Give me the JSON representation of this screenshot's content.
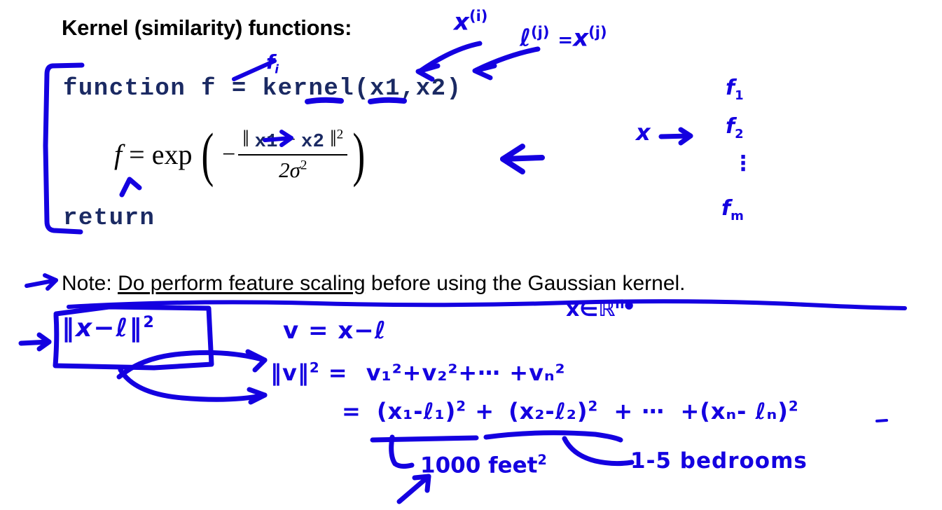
{
  "slide": {
    "title": "Kernel (similarity) functions:",
    "code": {
      "line1": "function f = kernel(x1,x2)",
      "line2": "return"
    },
    "equation": {
      "lhs": "f",
      "equals": "=",
      "exp": "exp",
      "open_paren": "(",
      "minus": "−",
      "numerator_open": "‖",
      "numerator_a": "x1",
      "numerator_minus": "−",
      "numerator_b": "x2",
      "numerator_close": "‖",
      "numerator_power": "2",
      "denominator": "2σ",
      "denominator_power": "2",
      "close_paren": ")"
    },
    "note": {
      "lead": "Note:",
      "underlined": "Do perform feature scaling",
      "tail": " before using the Gaussian kernel."
    }
  },
  "annotations": {
    "f_sub_i": "f",
    "f_sub_i_sub": "i",
    "x_superscript_i": "x",
    "x_superscript_i_sup": "(i)",
    "l_superscript_j": "ℓ",
    "l_superscript_j_sup": "(j)",
    "l_equals": "=",
    "x_superscript_j": "x",
    "x_superscript_j_sup": "(j)",
    "x_maps": "x",
    "feature_list": [
      "f",
      "f",
      "⋮",
      "f"
    ],
    "feature_subs": [
      "1",
      "2",
      "",
      "m"
    ],
    "boxed_norm_open": "‖",
    "boxed_norm_x": "x",
    "boxed_norm_minus": "−",
    "boxed_norm_l": "ℓ",
    "boxed_norm_close": "‖",
    "boxed_norm_power": "2",
    "v_def": "v = x−ℓ",
    "norm_v": "‖v‖",
    "norm_v_power": "2",
    "norm_v_equals": "=",
    "norm_v_expansion": "v₁²+v₂²+⋯ +vₙ²",
    "expansion_equals": "=",
    "expansion_term1": "(x₁-ℓ₁)",
    "expansion_term1_pow": "2",
    "expansion_plus1": "+",
    "expansion_term2": "(x₂-ℓ₂)",
    "expansion_term2_pow": "2",
    "expansion_plus2": "+ ⋯",
    "expansion_plus3": "+",
    "expansion_termn": "(xₙ- ℓₙ)",
    "expansion_termn_pow": "2",
    "x_in_rn": "x∈ℝ",
    "x_in_rn_sup": "n",
    "x_in_rn_scribble": "●",
    "units_feet": "1000 feet",
    "units_feet_sup": "2",
    "units_bedrooms": "1-5 bedrooms"
  },
  "colors": {
    "ink": "#1400e0",
    "code": "#1b2a63",
    "text": "#000000",
    "background": "#ffffff"
  }
}
